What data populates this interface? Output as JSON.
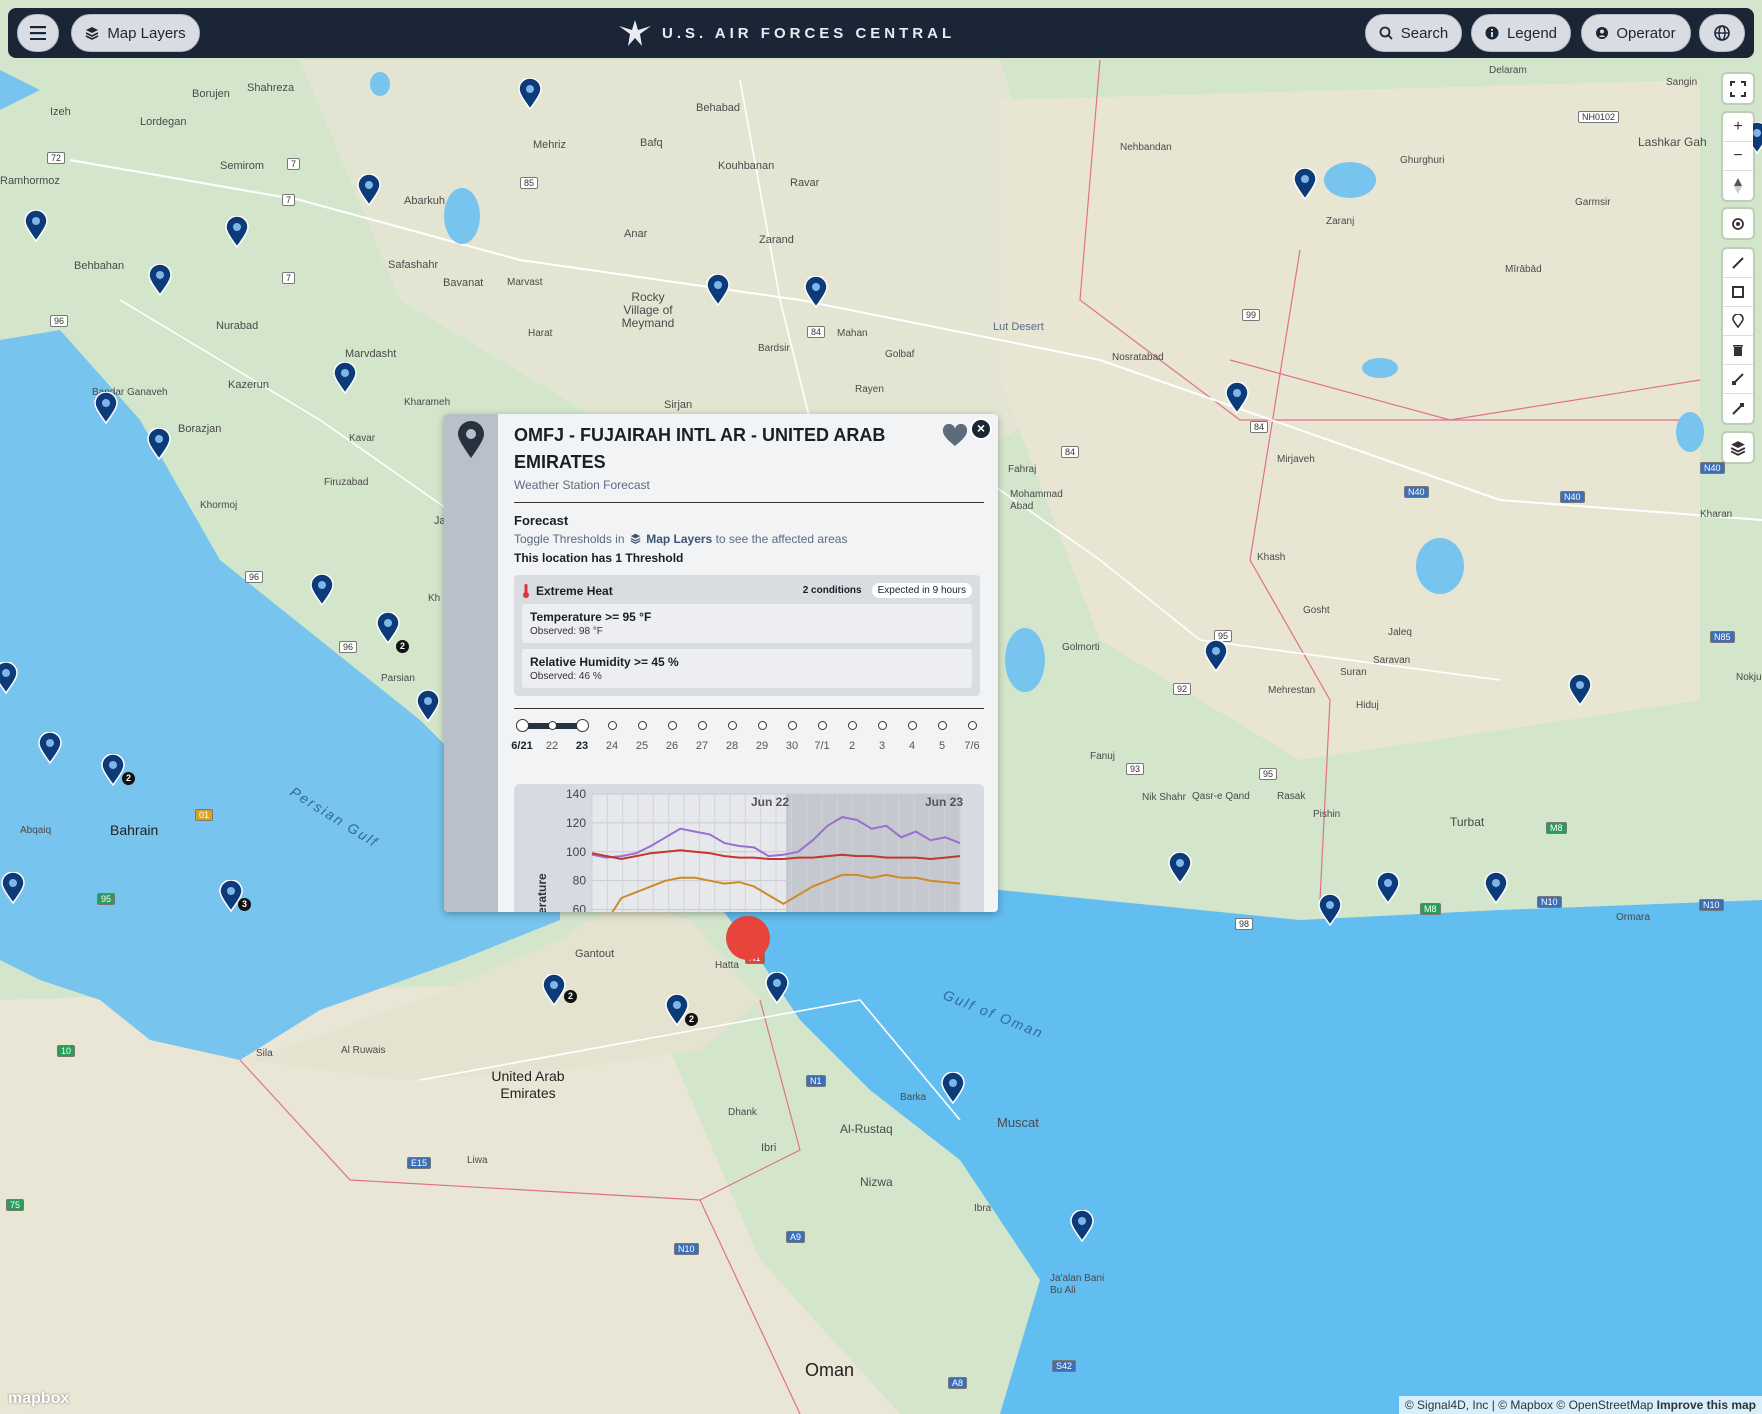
{
  "topbar": {
    "menu_icon": "hamburger-icon",
    "map_layers_label": "Map Layers",
    "brand_text": "U.S. AIR FORCES CENTRAL",
    "search_label": "Search",
    "legend_label": "Legend",
    "operator_label": "Operator",
    "globe_icon": "globe-icon"
  },
  "map_labels": {
    "borujen": "Borujen",
    "shahreza": "Shahreza",
    "izeh": "Izeh",
    "lordegan": "Lordegan",
    "semirom": "Semirom",
    "ramhormoz": "Ramhormoz",
    "mehriz": "Mehriz",
    "behabad": "Behabad",
    "bafq": "Bafq",
    "kouhbanan": "Kouhbanan",
    "ravar": "Ravar",
    "anar": "Anar",
    "zarand": "Zarand",
    "abarkuh": "Abarkuh",
    "behbahan": "Behbahan",
    "safashahr": "Safashahr",
    "bavanat": "Bavanat",
    "marvdasht": "Marvdasht",
    "nurabad": "Nurabad",
    "kazerun": "Kazerun",
    "borazjan": "Borazjan",
    "bandar_ganaveh": "Bandar Ganaveh",
    "kharameh": "Kharameh",
    "kavar": "Kavar",
    "firuzabad": "Firuzabad",
    "khormoj": "Khormoj",
    "marvast": "Marvast",
    "harat": "Harat",
    "rocky_village": "Rocky Village of Meymand",
    "bardsir": "Bardsir",
    "mahan": "Mahan",
    "golbaf": "Golbaf",
    "sirjan": "Sirjan",
    "rayen": "Rayen",
    "lut_desert": "Lut Desert",
    "nehbandan": "Nehbandan",
    "delaram": "Delaram",
    "sangin": "Sangin",
    "lashkar_gah": "Lashkar Gah",
    "ghurghuri": "Ghurghuri",
    "garmsir": "Garmsir",
    "zaranj": "Zaranj",
    "mirabad": "Mīrābād",
    "nosratabad": "Nosratabad",
    "fahraj": "Fahraj",
    "mohammad_abad": "Mohammad Abad",
    "mirjaveh": "Mirjaveh",
    "khash": "Khash",
    "kharan": "Kharan",
    "nokju": "Nokju",
    "gosht": "Gosht",
    "jaleq": "Jaleq",
    "saravan": "Saravan",
    "suran": "Suran",
    "mehrestan": "Mehrestan",
    "hiduj": "Hiduj",
    "golmorti": "Golmorti",
    "fanuj": "Fanuj",
    "nik_shahr": "Nik Shahr",
    "qasr_e_qand": "Qasr-e Qand",
    "rasak": "Rasak",
    "pishin": "Pishin",
    "turbat": "Turbat",
    "ormara": "Ormara",
    "parsian": "Parsian",
    "bahrain": "Bahrain",
    "abqaiq": "Abqaiq",
    "persian_gulf": "Persian Gulf",
    "gantout": "Gantout",
    "hatta": "Hatta",
    "gulf_of_oman": "Gulf of Oman",
    "sila": "Sila",
    "al_ruwais": "Al Ruwais",
    "uae": "United Arab Emirates",
    "dhank": "Dhank",
    "ibri": "Ibri",
    "barka": "Barka",
    "muscat": "Muscat",
    "al_rustaq": "Al-Rustaq",
    "nizwa": "Nizwa",
    "ibra": "Ibra",
    "liwa": "Liwa",
    "jaalan": "Ja'alan Bani Bu Ali",
    "oman": "Oman",
    "ja": "Ja",
    "kh": "Kh"
  },
  "road_shields": {
    "r72": "72",
    "r7a": "7",
    "r7b": "7",
    "r7c": "7",
    "r85": "85",
    "r96a": "96",
    "r96b": "96",
    "r96c": "96",
    "r84a": "84",
    "r84b": "84",
    "r84c": "84",
    "r99": "99",
    "nh0102": "NH0102",
    "n40a": "N40",
    "n40b": "N40",
    "n40c": "N40",
    "r95a": "95",
    "r95b": "95",
    "r92": "92",
    "r93": "93",
    "r98": "98",
    "m8a": "M8",
    "m8b": "M8",
    "n10a": "N10",
    "n10b": "N10",
    "n85": "N85",
    "n1": "N1",
    "e15": "E15",
    "n10c": "N10",
    "a9": "A9",
    "s42": "S42",
    "a8": "A8",
    "r01": "01",
    "r95c": "95",
    "r10": "10",
    "r75": "75",
    "n11": "N1"
  },
  "cluster_badges": {
    "c1": "2",
    "c2": "2",
    "c3": "3",
    "c4": "2",
    "c5": "2"
  },
  "popup": {
    "pin_icon": "location-pin-icon",
    "title": "OMFJ - FUJAIRAH INTL AR - UNITED ARAB EMIRATES",
    "subtitle": "Weather Station Forecast",
    "favorite_icon": "heart-icon",
    "close_icon": "close-icon",
    "forecast_title": "Forecast",
    "toggle_prefix": "Toggle Thresholds in",
    "toggle_link": "Map Layers",
    "toggle_suffix": "to see the affected areas",
    "threshold_count": "This location has 1 Threshold",
    "threshold": {
      "name": "Extreme Heat",
      "icon": "thermometer-icon",
      "conditions_chip": "2 conditions",
      "expected_chip": "Expected in 9 hours",
      "conditions": [
        {
          "title": "Temperature >= 95 °F",
          "observed": "Observed: 98 °F"
        },
        {
          "title": "Relative Humidity >= 45 %",
          "observed": "Observed: 46 %"
        }
      ]
    },
    "timeline": {
      "labels": [
        "6/21",
        "22",
        "23",
        "24",
        "25",
        "26",
        "27",
        "28",
        "29",
        "30",
        "7/1",
        "2",
        "3",
        "4",
        "5",
        "7/6"
      ],
      "selected_start": 0,
      "selected_end": 2
    }
  },
  "chart_data": {
    "type": "line",
    "top_labels": [
      "Jun 22",
      "Jun 23"
    ],
    "ylabel": "erature",
    "y_ticks": [
      60,
      80,
      100,
      120,
      140
    ],
    "ylim": [
      50,
      140
    ],
    "series": [
      {
        "color": "#9b6fd1",
        "values": [
          98,
          96,
          97,
          99,
          104,
          110,
          116,
          114,
          112,
          106,
          104,
          103,
          97,
          98,
          100,
          108,
          118,
          124,
          122,
          116,
          118,
          110,
          114,
          108,
          110,
          106
        ]
      },
      {
        "color": "#c0392b",
        "values": [
          99,
          97,
          95,
          97,
          99,
          100,
          101,
          100,
          99,
          97,
          96,
          96,
          95,
          95,
          96,
          96,
          97,
          98,
          97,
          97,
          96,
          96,
          96,
          95,
          96,
          97
        ]
      },
      {
        "color": "#cf8a26",
        "values": [
          48,
          52,
          68,
          72,
          76,
          80,
          82,
          82,
          80,
          78,
          79,
          76,
          70,
          64,
          70,
          76,
          80,
          84,
          84,
          82,
          84,
          82,
          82,
          80,
          79,
          78
        ]
      }
    ]
  },
  "attribution": "© Signal4D, Inc | © Mapbox © OpenStreetMap",
  "attribution_link": "Improve this map",
  "mapbox_logo": "mapbox"
}
